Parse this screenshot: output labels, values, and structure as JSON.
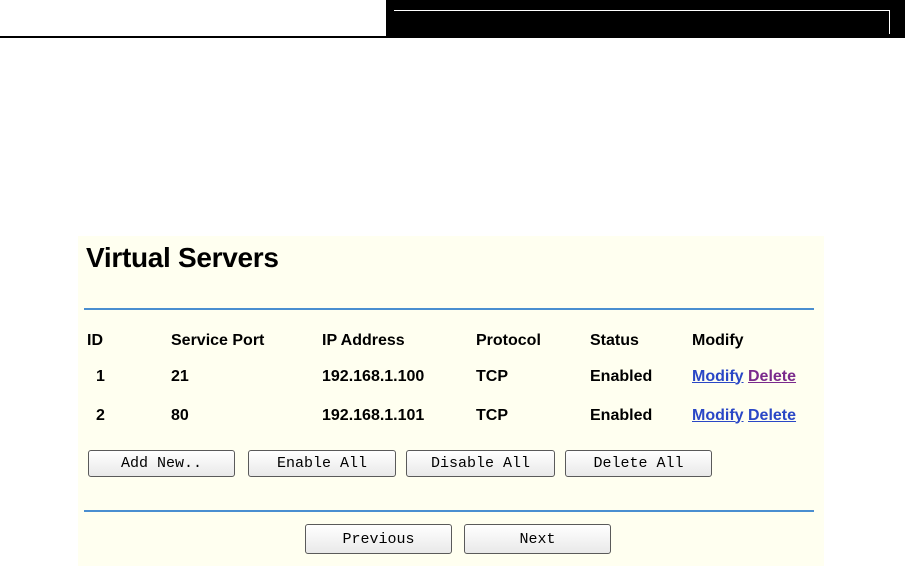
{
  "page": {
    "title": "Virtual Servers"
  },
  "table": {
    "headers": {
      "id": "ID",
      "service_port": "Service Port",
      "ip_address": "IP Address",
      "protocol": "Protocol",
      "status": "Status",
      "modify": "Modify"
    },
    "rows": [
      {
        "id": "1",
        "service_port": "21",
        "ip_address": "192.168.1.100",
        "protocol": "TCP",
        "status": "Enabled",
        "modify_label": "Modify",
        "delete_label": "Delete"
      },
      {
        "id": "2",
        "service_port": "80",
        "ip_address": "192.168.1.101",
        "protocol": "TCP",
        "status": "Enabled",
        "modify_label": "Modify",
        "delete_label": "Delete"
      }
    ]
  },
  "actions": {
    "add_new": "Add New..",
    "enable_all": "Enable All",
    "disable_all": "Disable All",
    "delete_all": "Delete All"
  },
  "pagination": {
    "previous": "Previous",
    "next": "Next"
  },
  "colors": {
    "panel_bg": "#fffff0",
    "rule": "#4a8ed0",
    "link": "#2a47c6",
    "link_visited": "#7a2a8c"
  }
}
